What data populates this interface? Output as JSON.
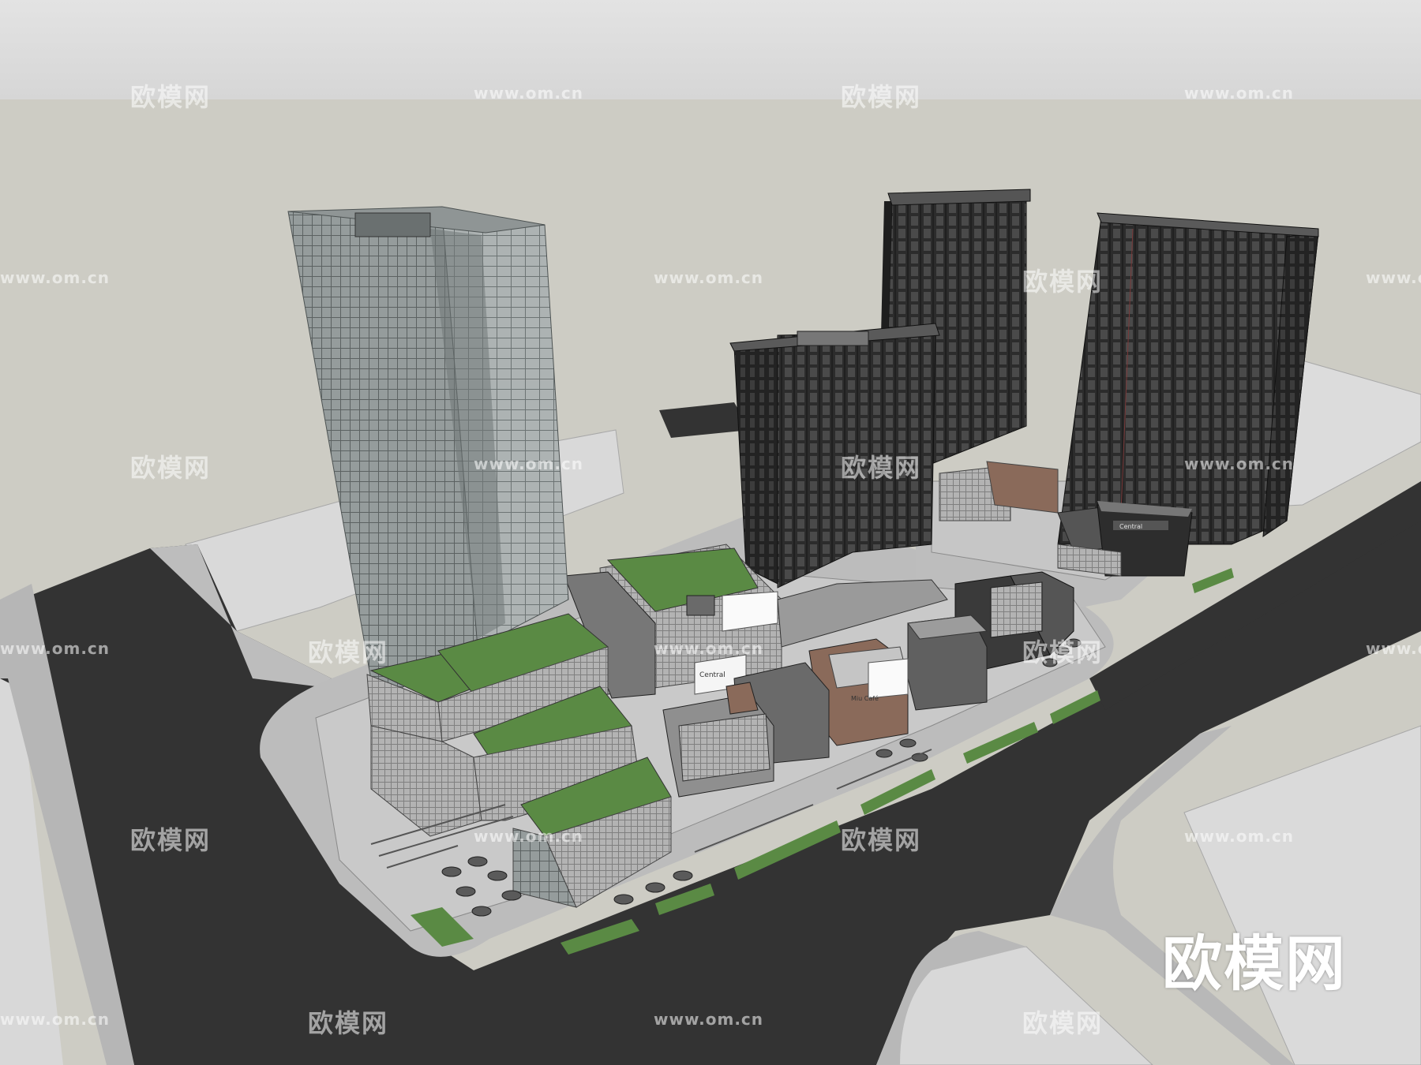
{
  "watermarks": {
    "brand": "欧模网",
    "url": "www.om.cn"
  },
  "signage": {
    "retail_sign": "Central",
    "cafe_sign": "Miu Café",
    "annex_sign": "Central"
  },
  "colors": {
    "sky": "#dedede",
    "ground": "#cdccc4",
    "road": "#333333",
    "sidewalk": "#b9b9b9",
    "lawn": "#5a8a44",
    "glass": "#a9afaf",
    "dark_tower": "#3a3a3a"
  }
}
